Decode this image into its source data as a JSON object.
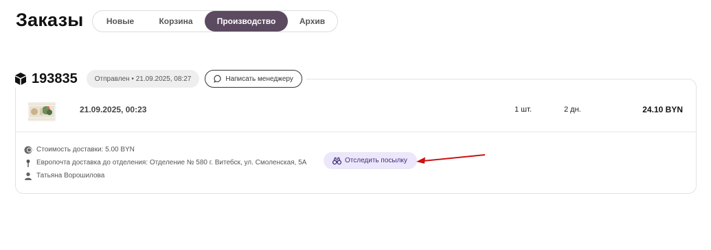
{
  "header": {
    "title": "Заказы"
  },
  "tabs": [
    {
      "label": "Новые",
      "active": false
    },
    {
      "label": "Корзина",
      "active": false
    },
    {
      "label": "Производство",
      "active": true
    },
    {
      "label": "Архив",
      "active": false
    }
  ],
  "order": {
    "number": "193835",
    "status": "Отправлен • 21.09.2025, 08:27",
    "manager_button": "Написать менеджеру",
    "product": {
      "date": "21.09.2025, 00:23",
      "quantity": "1 шт.",
      "days": "2 дн.",
      "price": "24.10 BYN"
    },
    "delivery_cost": "Стоимость доставки: 5.00 BYN",
    "delivery_address": "Европочта доставка до отделения: Отделение № 580 г. Витебск, ул. Смоленская, 5А",
    "recipient": "Татьяна Ворошилова",
    "track_button": "Отследить посылку"
  },
  "colors": {
    "active_tab": "#5c4a61",
    "track_button_bg": "#ece7fb",
    "annotation_arrow": "#cc1111"
  },
  "icons": [
    "box-icon",
    "chat-icon",
    "coins-icon",
    "map-pin-icon",
    "person-icon",
    "binoculars-icon"
  ]
}
